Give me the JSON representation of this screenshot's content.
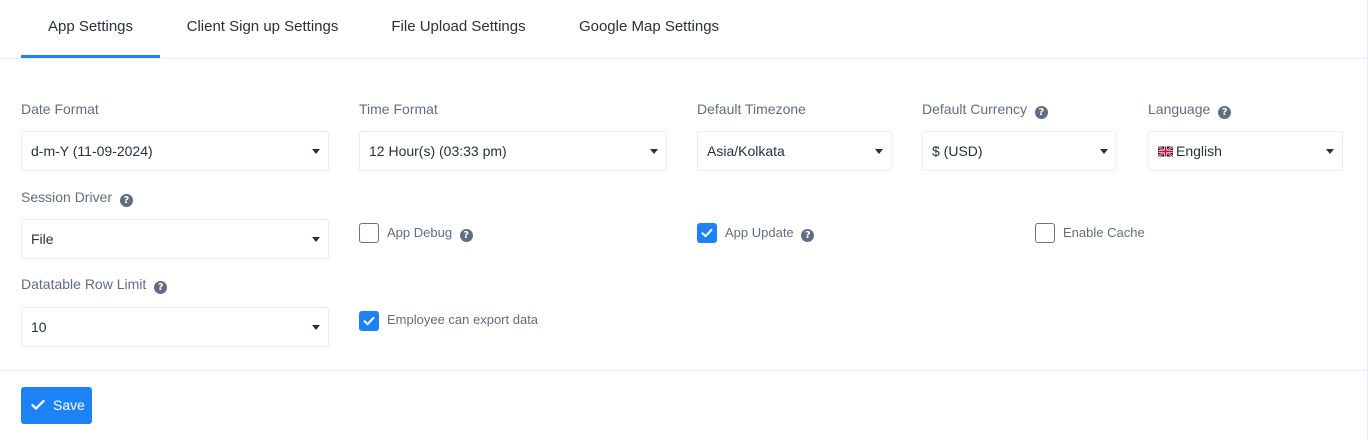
{
  "tabs": [
    {
      "label": "App Settings",
      "active": true
    },
    {
      "label": "Client Sign up Settings",
      "active": false
    },
    {
      "label": "File Upload Settings",
      "active": false
    },
    {
      "label": "Google Map Settings",
      "active": false
    }
  ],
  "fields": {
    "date_format": {
      "label": "Date Format",
      "value": "d-m-Y (11-09-2024)"
    },
    "time_format": {
      "label": "Time Format",
      "value": "12 Hour(s) (03:33 pm)"
    },
    "default_timezone": {
      "label": "Default Timezone",
      "value": "Asia/Kolkata"
    },
    "default_currency": {
      "label": "Default Currency",
      "value": "$ (USD)"
    },
    "language": {
      "label": "Language",
      "value": "English"
    },
    "session_driver": {
      "label": "Session Driver",
      "value": "File"
    },
    "datatable_row_limit": {
      "label": "Datatable Row Limit",
      "value": "10"
    }
  },
  "checkboxes": {
    "app_debug": {
      "label": "App Debug",
      "checked": false
    },
    "app_update": {
      "label": "App Update",
      "checked": true
    },
    "enable_cache": {
      "label": "Enable Cache",
      "checked": false
    },
    "employee_export": {
      "label": "Employee can export data",
      "checked": true
    }
  },
  "help_glyph": "?",
  "icons": {
    "help": "question-circle-icon",
    "caret": "caret-down-icon",
    "flag": "uk-flag-icon",
    "check": "check-icon"
  },
  "colors": {
    "accent": "#1d82f5",
    "text": "#28313c",
    "muted": "#616e80",
    "border": "#e8eef3"
  },
  "save_label": "Save"
}
